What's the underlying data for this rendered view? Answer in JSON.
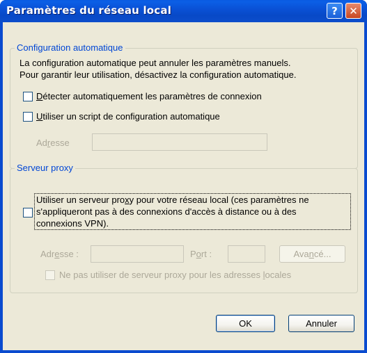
{
  "window": {
    "title": "Paramètres du réseau local",
    "help": "?",
    "close": "✕"
  },
  "auto_config": {
    "legend": "Configuration automatique",
    "description_line1": "La configuration automatique peut annuler les paramètres manuels.",
    "description_line2": "Pour garantir leur utilisation, désactivez la configuration automatique.",
    "detect_pre": "",
    "detect_u": "D",
    "detect_post": "étecter automatiquement les paramètres de connexion",
    "script_pre": "",
    "script_u": "U",
    "script_post": "tiliser un script de configuration automatique",
    "address_pre": "Ad",
    "address_u": "r",
    "address_post": "esse",
    "address_value": ""
  },
  "proxy": {
    "legend": "Serveur proxy",
    "use_line1_pre": "Utiliser un serveur pro",
    "use_line1_u": "x",
    "use_line1_post": "y pour votre réseau local (ces paramètres ne",
    "use_line2": "s'appliqueront pas à des connexions d'accès à distance ou à des",
    "use_line3": "connexions VPN).",
    "address_pre": "Adr",
    "address_u": "e",
    "address_post": "sse :",
    "address_value": "",
    "port_pre": "P",
    "port_u": "o",
    "port_post": "rt :",
    "port_value": "",
    "advanced_pre": "Ava",
    "advanced_u": "n",
    "advanced_post": "cé...",
    "bypass_pre": "Ne pas utiliser de serveur proxy pour les adresses ",
    "bypass_u": "l",
    "bypass_post": "ocales"
  },
  "buttons": {
    "ok": "OK",
    "cancel": "Annuler"
  }
}
